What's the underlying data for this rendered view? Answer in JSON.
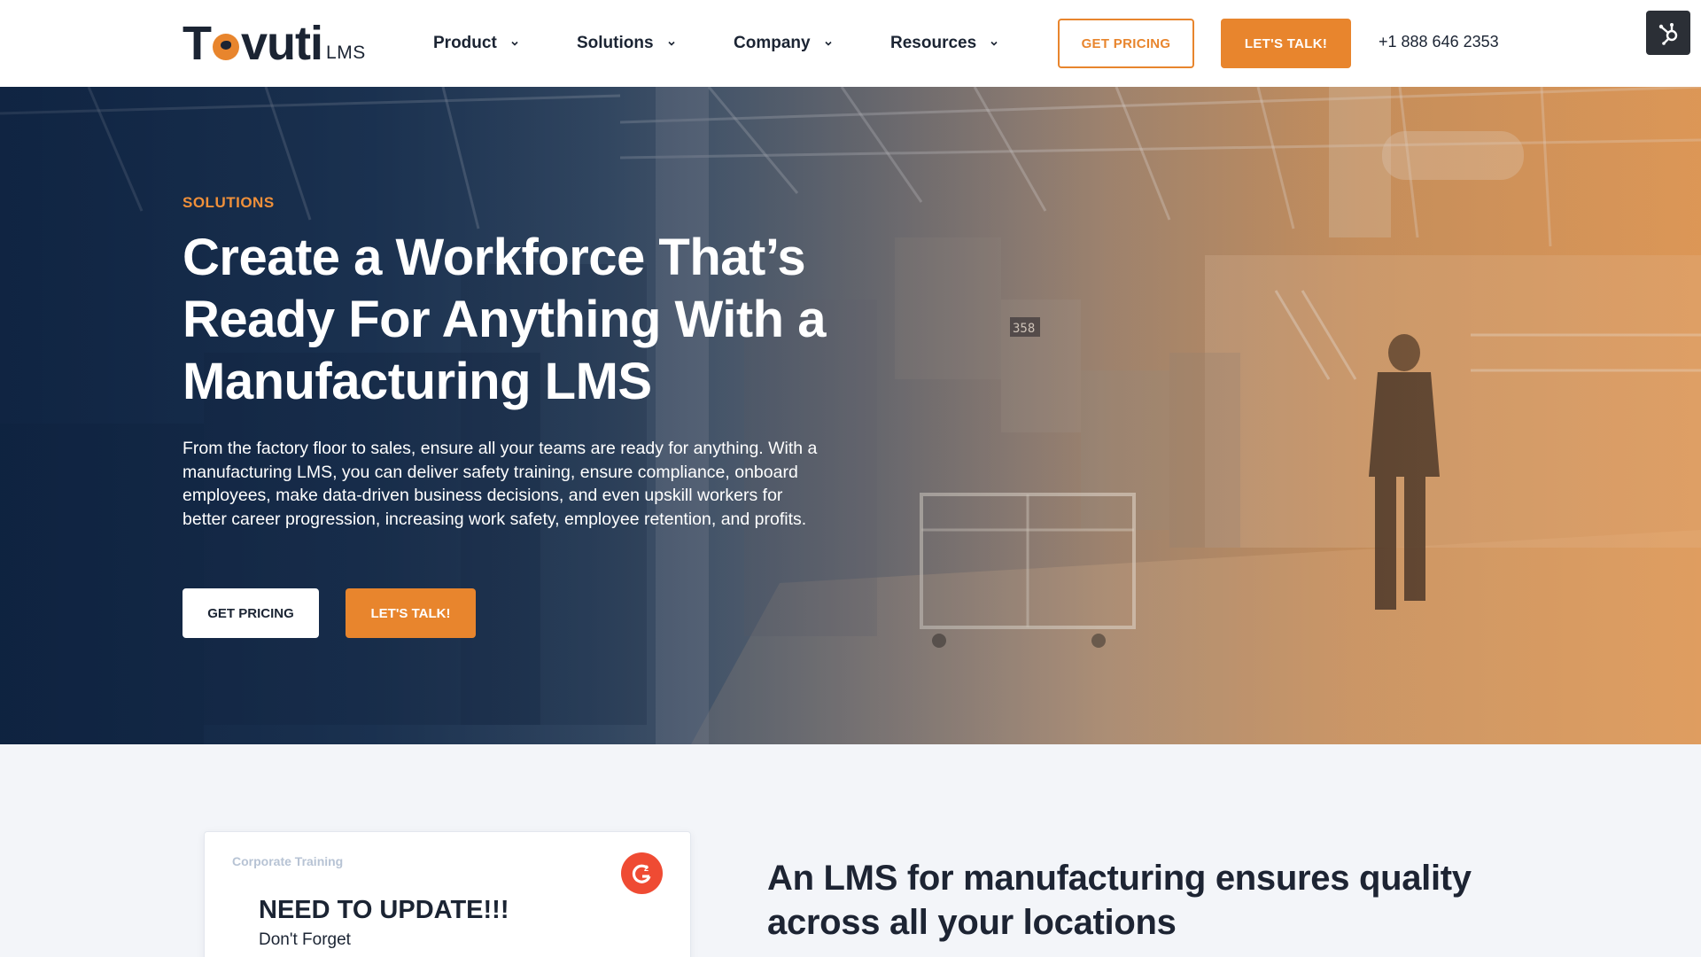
{
  "header": {
    "logo_text": "Tovuti",
    "logo_suffix": "LMS",
    "nav": [
      {
        "label": "Product"
      },
      {
        "label": "Solutions"
      },
      {
        "label": "Company"
      },
      {
        "label": "Resources"
      }
    ],
    "get_pricing_label": "GET PRICING",
    "lets_talk_label": "LET'S TALK!",
    "phone": "+1 888 646 2353",
    "hub_icon": "hubspot-icon"
  },
  "hero": {
    "eyebrow": "SOLUTIONS",
    "title": "Create a Workforce That’s Ready For Anything With a Manufacturing LMS",
    "body": "From the factory floor to sales, ensure all your teams are ready for anything. With a manufacturing LMS, you can deliver safety training, ensure compliance, onboard employees, make data-driven business decisions, and even upskill workers for better career progression, increasing work safety, employee retention, and profits.",
    "get_pricing_label": "GET PRICING",
    "lets_talk_label": "LET'S TALK!",
    "machine_label": "358"
  },
  "card": {
    "tag": "Corporate Training",
    "title": "NEED TO UPDATE!!!",
    "subtitle": "Don't Forget",
    "badge_icon": "g2-icon"
  },
  "section": {
    "title": "An LMS for manufacturing ensures quality across all your locations"
  },
  "colors": {
    "accent": "#e8852d",
    "navy": "#142a48",
    "text": "#1b2433"
  }
}
